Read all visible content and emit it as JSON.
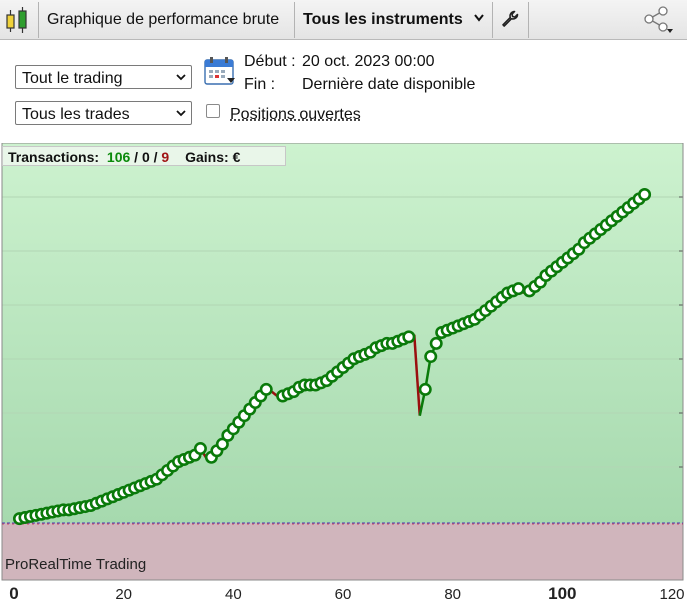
{
  "toolbar": {
    "title": "Graphique de performance brute",
    "instrument": "Tous les instruments",
    "icons": [
      "candlestick-icon",
      "chevron-down-icon",
      "wrench-icon",
      "share-icon"
    ]
  },
  "filters": {
    "trading_select": "Tout le trading",
    "trades_select": "Tous les trades",
    "start_label": "Début :",
    "start_value": "20 oct. 2023 00:00",
    "end_label": "Fin :",
    "end_value": "Dernière date disponible",
    "open_positions_label": "Positions ouvertes",
    "open_positions_checked": false
  },
  "legend": {
    "transactions_label": "Transactions:",
    "wins": "106",
    "neutral": "0",
    "losses": "9",
    "sep1": " / ",
    "sep2": " / ",
    "gains_label": "Gains: €"
  },
  "watermark": "ProRealTime Trading",
  "colors": {
    "win": "#0a7a0a",
    "loss": "#9a0f0f",
    "profit_bg": "#c9f0cc",
    "loss_bg": "#d0b5bc",
    "zero_line": "#5a5ab4"
  },
  "chart_data": {
    "type": "line",
    "title": "",
    "xlabel": "",
    "ylabel": "",
    "x_ticks": [
      "0",
      "20",
      "40",
      "60",
      "80",
      "100",
      "120"
    ],
    "xlim": [
      0,
      120
    ],
    "ylim": [
      -2,
      20
    ],
    "y_unit_note": "Y axis values not printed; relative cumulative gain units",
    "grid": true,
    "series": [
      {
        "points": [
          [
            1,
            0.2
          ],
          [
            2,
            0.25
          ],
          [
            3,
            0.3
          ],
          [
            4,
            0.35
          ],
          [
            5,
            0.4
          ],
          [
            6,
            0.45
          ],
          [
            7,
            0.5
          ],
          [
            8,
            0.55
          ],
          [
            9,
            0.6
          ],
          [
            10,
            0.6
          ],
          [
            11,
            0.65
          ],
          [
            12,
            0.7
          ],
          [
            13,
            0.75
          ],
          [
            14,
            0.8
          ],
          [
            15,
            0.9
          ],
          [
            16,
            1.0
          ],
          [
            17,
            1.1
          ],
          [
            18,
            1.2
          ],
          [
            19,
            1.3
          ],
          [
            20,
            1.4
          ],
          [
            21,
            1.5
          ],
          [
            22,
            1.6
          ],
          [
            23,
            1.7
          ],
          [
            24,
            1.8
          ],
          [
            25,
            1.9
          ],
          [
            26,
            2.0
          ],
          [
            27,
            2.2
          ],
          [
            28,
            2.4
          ],
          [
            29,
            2.6
          ],
          [
            30,
            2.8
          ],
          [
            31,
            2.9
          ],
          [
            32,
            3.0
          ],
          [
            33,
            3.1
          ],
          [
            34,
            3.4
          ],
          [
            35,
            3.0
          ],
          [
            36,
            3.0
          ],
          [
            37,
            3.3
          ],
          [
            38,
            3.6
          ],
          [
            39,
            4.0
          ],
          [
            40,
            4.3
          ],
          [
            41,
            4.6
          ],
          [
            42,
            4.9
          ],
          [
            43,
            5.2
          ],
          [
            44,
            5.5
          ],
          [
            45,
            5.8
          ],
          [
            46,
            6.1
          ],
          [
            47,
            6.0
          ],
          [
            48,
            5.8
          ],
          [
            49,
            5.8
          ],
          [
            50,
            5.9
          ],
          [
            51,
            6.0
          ],
          [
            52,
            6.2
          ],
          [
            53,
            6.3
          ],
          [
            54,
            6.3
          ],
          [
            55,
            6.3
          ],
          [
            56,
            6.4
          ],
          [
            57,
            6.5
          ],
          [
            58,
            6.7
          ],
          [
            59,
            6.9
          ],
          [
            60,
            7.1
          ],
          [
            61,
            7.3
          ],
          [
            62,
            7.5
          ],
          [
            63,
            7.6
          ],
          [
            64,
            7.7
          ],
          [
            65,
            7.8
          ],
          [
            66,
            8.0
          ],
          [
            67,
            8.1
          ],
          [
            68,
            8.2
          ],
          [
            69,
            8.2
          ],
          [
            70,
            8.3
          ],
          [
            71,
            8.4
          ],
          [
            72,
            8.5
          ],
          [
            73,
            8.6
          ],
          [
            74,
            4.9
          ],
          [
            75,
            6.1
          ],
          [
            76,
            7.6
          ],
          [
            77,
            8.2
          ],
          [
            78,
            8.7
          ],
          [
            79,
            8.8
          ],
          [
            80,
            8.9
          ],
          [
            81,
            9.0
          ],
          [
            82,
            9.1
          ],
          [
            83,
            9.2
          ],
          [
            84,
            9.3
          ],
          [
            85,
            9.5
          ],
          [
            86,
            9.7
          ],
          [
            87,
            9.9
          ],
          [
            88,
            10.1
          ],
          [
            89,
            10.3
          ],
          [
            90,
            10.5
          ],
          [
            91,
            10.6
          ],
          [
            92,
            10.7
          ],
          [
            93,
            10.5
          ],
          [
            94,
            10.6
          ],
          [
            95,
            10.8
          ],
          [
            96,
            11.0
          ],
          [
            97,
            11.3
          ],
          [
            98,
            11.5
          ],
          [
            99,
            11.7
          ],
          [
            100,
            11.9
          ],
          [
            101,
            12.1
          ],
          [
            102,
            12.3
          ],
          [
            103,
            12.5
          ],
          [
            104,
            12.8
          ],
          [
            105,
            13.0
          ],
          [
            106,
            13.2
          ],
          [
            107,
            13.4
          ],
          [
            108,
            13.6
          ],
          [
            109,
            13.8
          ],
          [
            110,
            14.0
          ],
          [
            111,
            14.2
          ],
          [
            112,
            14.4
          ],
          [
            113,
            14.6
          ],
          [
            114,
            14.8
          ],
          [
            115,
            15.0
          ]
        ]
      }
    ]
  }
}
